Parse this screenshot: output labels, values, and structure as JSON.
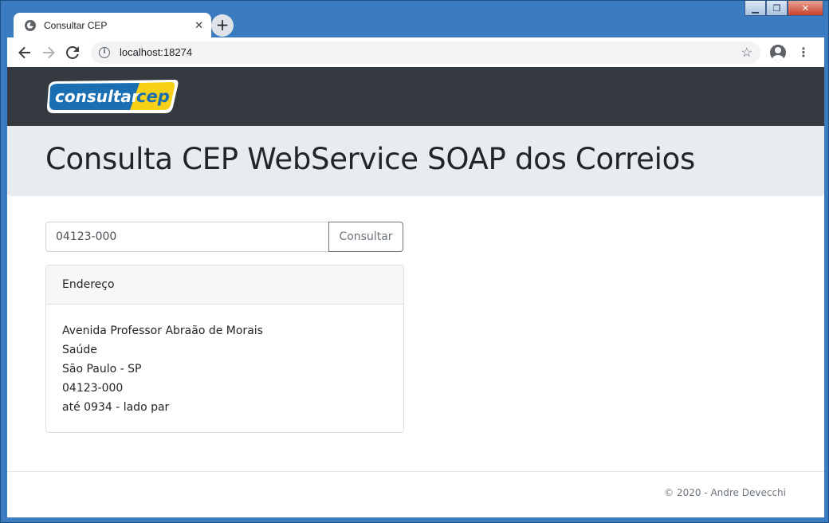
{
  "browser": {
    "tab_title": "Consultar CEP",
    "tab_close": "✕",
    "new_tab": "+",
    "url": "localhost:18274",
    "window_controls": {
      "minimize": "▁",
      "maximize": "❐",
      "close": "✕"
    }
  },
  "navbar": {
    "logo_part1": "consultar",
    "logo_part2": "cep"
  },
  "header": {
    "title": "Consulta CEP WebService SOAP dos Correios"
  },
  "search": {
    "value": "04123-000",
    "button_label": "Consultar"
  },
  "address_card": {
    "header": "Endereço",
    "lines": [
      "Avenida Professor Abraão de Morais",
      "Saúde",
      "São Paulo - SP",
      "04123-000",
      "até 0934 - lado par"
    ]
  },
  "footer": {
    "text": "© 2020 - Andre Devecchi"
  },
  "colors": {
    "navbar_bg": "#343a40",
    "jumbotron_bg": "#e9ecef",
    "logo_blue": "#1a6fb3",
    "logo_yellow": "#f7d117"
  }
}
